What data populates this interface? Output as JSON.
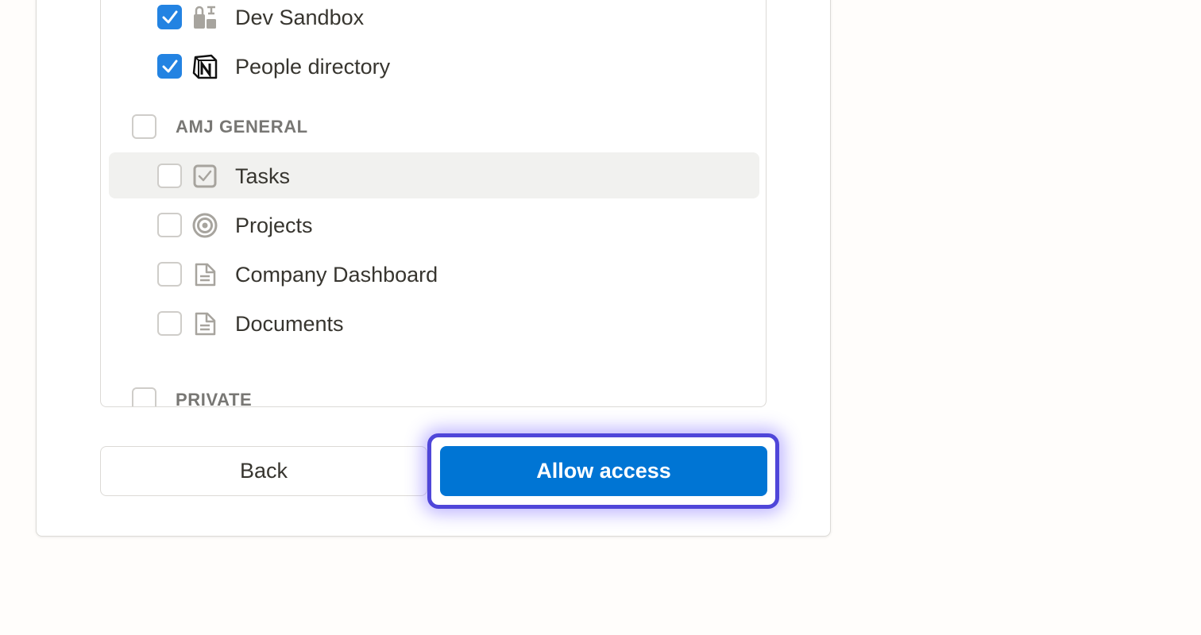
{
  "pages": {
    "items": [
      {
        "label": "Dev Sandbox",
        "checked": true,
        "icon": "sandbox-icon"
      },
      {
        "label": "People directory",
        "checked": true,
        "icon": "notion-logo-icon"
      }
    ]
  },
  "sections": [
    {
      "label": "AMJ GENERAL",
      "checked": false,
      "items": [
        {
          "label": "Tasks",
          "checked": false,
          "icon": "checkbox-icon",
          "hovered": true
        },
        {
          "label": "Projects",
          "checked": false,
          "icon": "target-icon"
        },
        {
          "label": "Company Dashboard",
          "checked": false,
          "icon": "document-icon"
        },
        {
          "label": "Documents",
          "checked": false,
          "icon": "document-icon"
        }
      ]
    },
    {
      "label": "PRIVATE",
      "checked": false,
      "items": []
    }
  ],
  "actions": {
    "back_label": "Back",
    "allow_label": "Allow access"
  },
  "colors": {
    "accent": "#2383e2",
    "primary_button": "#0075d4",
    "focus_ring": "#4f46d9",
    "hover_row": "#f1f1ef"
  }
}
